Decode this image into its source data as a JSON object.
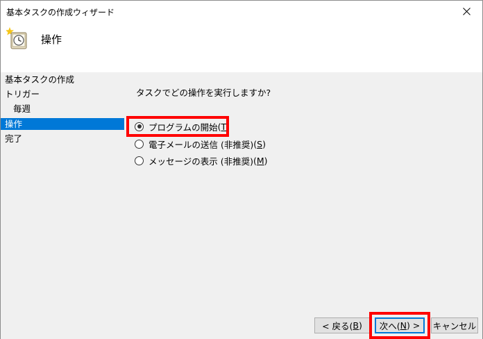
{
  "window": {
    "title": "基本タスクの作成ウィザード"
  },
  "header": {
    "title": "操作",
    "icon": "task-scheduler-icon"
  },
  "nav": {
    "items": [
      {
        "label": "基本タスクの作成"
      },
      {
        "label": "トリガー"
      },
      {
        "label": "毎週"
      },
      {
        "label": "操作"
      },
      {
        "label": "完了"
      }
    ]
  },
  "main": {
    "question": "タスクでどの操作を実行しますか?",
    "options": [
      {
        "label": "プログラムの開始",
        "key": "T",
        "checked": true
      },
      {
        "label": "電子メールの送信 (非推奨)",
        "key": "S",
        "checked": false
      },
      {
        "label": "メッセージの表示 (非推奨)",
        "key": "M",
        "checked": false
      }
    ]
  },
  "buttons": {
    "back": {
      "prefix": "< 戻る(",
      "key": "B",
      "suffix": ")"
    },
    "next": {
      "prefix": "次へ(",
      "key": "N",
      "suffix": ") >"
    },
    "cancel": "キャンセル"
  },
  "colors": {
    "selection": "#0078d7",
    "highlight": "#ff0000",
    "panel": "#f0f0f0"
  }
}
